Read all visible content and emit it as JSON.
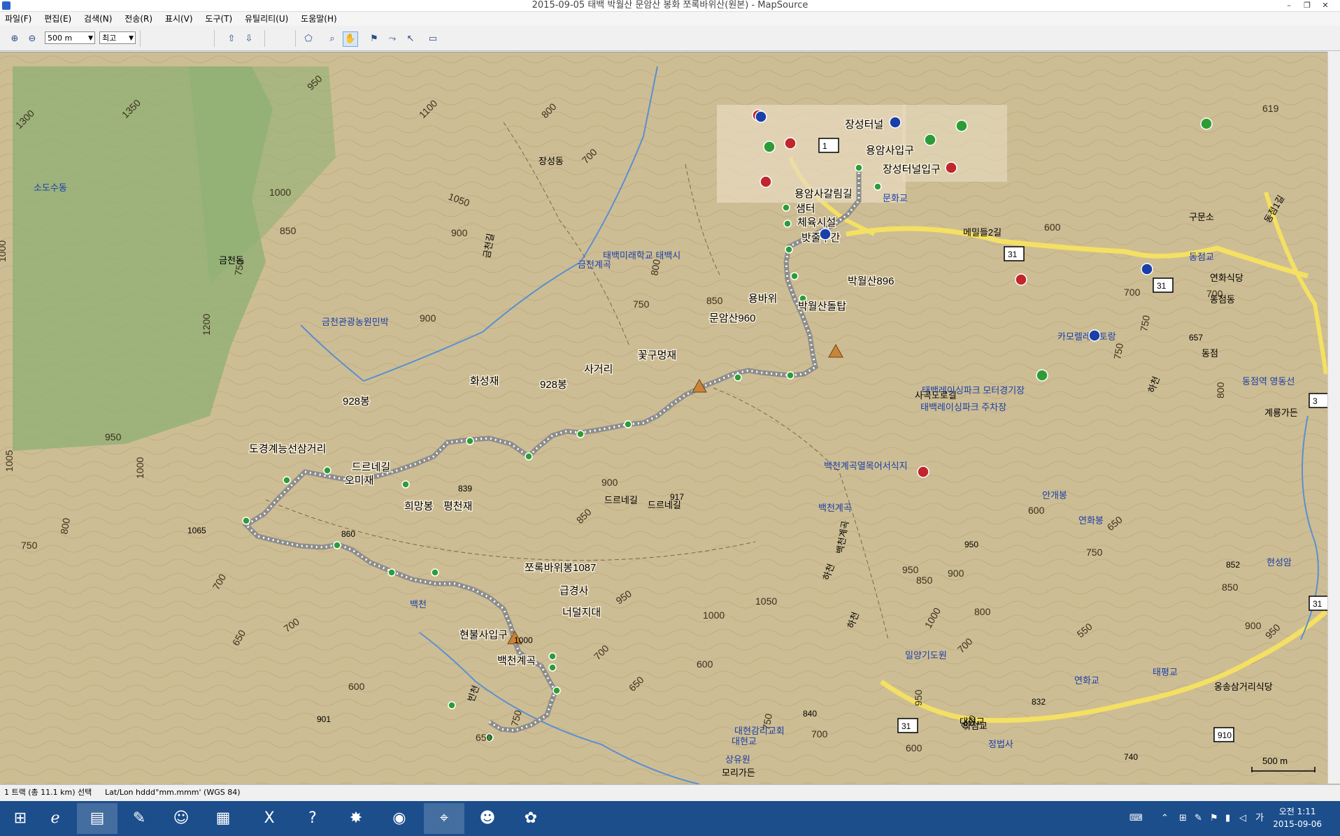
{
  "window": {
    "title": "2015-09-05 태백 박월산 문암산 봉화 쪼록바위산(원본) - MapSource",
    "minimize": "–",
    "restore": "❐",
    "close": "✕"
  },
  "menu": [
    "파일(F)",
    "편집(E)",
    "검색(N)",
    "전송(R)",
    "표시(V)",
    "도구(T)",
    "유틸리티(U)",
    "도움말(H)"
  ],
  "toolbar": {
    "zoom_level": "500 m",
    "detail_level": "최고",
    "colors": {
      "accent": "#7aa7d8"
    }
  },
  "map": {
    "contour_labels": [
      "950",
      "1350",
      "1300",
      "1100",
      "800",
      "700",
      "1000",
      "1050",
      "900",
      "850",
      "750",
      "1000",
      "1200",
      "900",
      "800",
      "750",
      "850",
      "950",
      "1000",
      "1005",
      "750",
      "800",
      "700",
      "650",
      "700",
      "600",
      "650",
      "750",
      "900",
      "850",
      "950",
      "1000",
      "1050",
      "700",
      "650",
      "600",
      "750",
      "700",
      "600",
      "550",
      "700",
      "1000",
      "950",
      "850",
      "950",
      "900",
      "800",
      "750",
      "650",
      "550",
      "700",
      "600",
      "900",
      "850",
      "950",
      "800",
      "750",
      "600",
      "700",
      "750",
      "619"
    ],
    "route_labels": [
      "장성터널",
      "용암사입구",
      "장성터널입구",
      "용암사갈림길",
      "샘터",
      "체육시설",
      "밧줄구간",
      "박월산896",
      "박월산돌탑",
      "용바위",
      "문암산960",
      "꽃구멍재",
      "사거리",
      "928봉",
      "화성재",
      "928봉",
      "도경계능선삼거리",
      "드르네길",
      "오미재",
      "희망봉",
      "평천재",
      "쪼록바위봉1087",
      "급경사",
      "너덜지대",
      "현불사입구",
      "백천계곡"
    ],
    "place_labels": [
      "장성동",
      "소도수동",
      "금천동",
      "금천관광농원민박",
      "금천계곡",
      "태백미래학교 태백시",
      "문화교",
      "메밀들2길",
      "구문소",
      "동점교",
      "연화식당",
      "동점동",
      "동점역 영동선",
      "계룡가든",
      "카모렐레스토랑",
      "태백레이싱파크 모터경기장",
      "태백레이싱파크 주차장",
      "백천계곡열목어서식지",
      "백천계곡",
      "안개봉",
      "연화봉",
      "현성암",
      "밀양기도원",
      "대현교",
      "의점교",
      "정법사",
      "연화교",
      "태평교",
      "옹송삼거리식당",
      "대현감리교회",
      "대현교",
      "상유원",
      "모리가든",
      "백천",
      "빈천",
      "드르네길",
      "드르네길",
      "금천길",
      "하천",
      "사곡도로길",
      "하천",
      "하천",
      "동점",
      "동점1길",
      "백천계곡"
    ],
    "spot_heights": [
      "839",
      "917",
      "1065",
      "860",
      "1000",
      "901",
      "840",
      "832",
      "740",
      "950",
      "852",
      "657",
      "756"
    ],
    "road_shields": [
      "31",
      "31",
      "31",
      "31",
      "910",
      "1",
      "3"
    ],
    "scale_label": "500 m",
    "colors": {
      "terrain": "#c9b88f",
      "forest": "#8cb073",
      "contour": "#b59c70",
      "route_line": "#8c8c8c",
      "route_dot": "#ffffff",
      "waypoint": "#2e9c36",
      "road_yellow": "#f4e062",
      "water": "#5b8fd0",
      "label": "#000000",
      "place_blue": "#1a3fa8"
    }
  },
  "status": {
    "left": "1 트랙 (총 11.1 km) 선택",
    "right": "Lat/Lon hddd°mm.mmm' (WGS 84)"
  },
  "taskbar": {
    "apps": [
      "windows-start",
      "internet-explorer",
      "file-explorer",
      "paint",
      "media",
      "calculator",
      "excel",
      "help",
      "flash",
      "google-earth",
      "mapsource",
      "messenger",
      "kakao"
    ],
    "tray_lang": "가",
    "time": "오전 1:11",
    "date": "2015-09-06"
  }
}
